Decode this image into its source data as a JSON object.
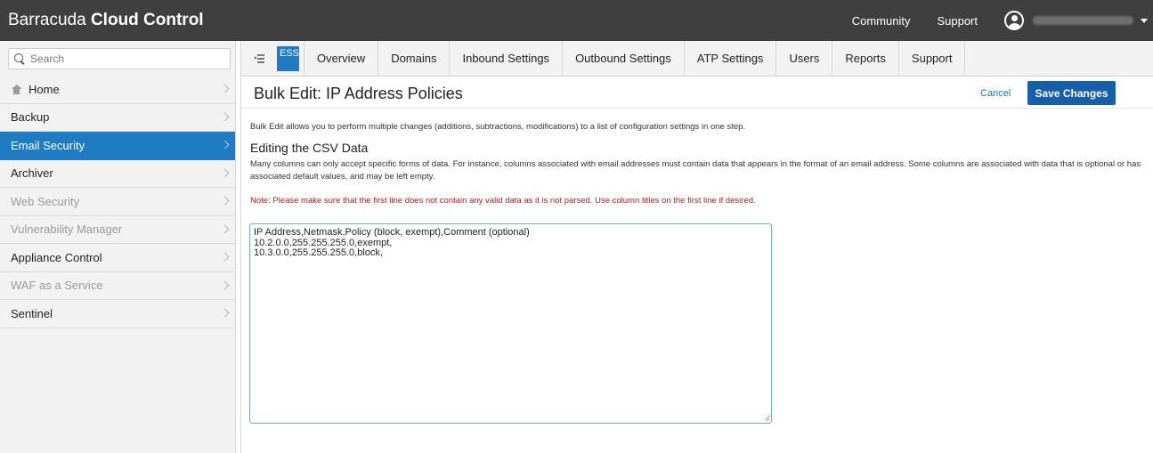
{
  "app": {
    "brand_light": "Barracuda",
    "brand_bold": "Cloud Control"
  },
  "topnav": {
    "community": "Community",
    "support": "Support"
  },
  "sidebar": {
    "search_placeholder": "Search",
    "items": [
      {
        "label": "Home",
        "icon": "home-icon",
        "state": "normal"
      },
      {
        "label": "Backup",
        "state": "normal"
      },
      {
        "label": "Email Security",
        "state": "active"
      },
      {
        "label": "Archiver",
        "state": "normal"
      },
      {
        "label": "Web Security",
        "state": "disabled"
      },
      {
        "label": "Vulnerability Manager",
        "state": "disabled"
      },
      {
        "label": "Appliance Control",
        "state": "normal"
      },
      {
        "label": "WAF as a Service",
        "state": "disabled"
      },
      {
        "label": "Sentinel",
        "state": "normal"
      }
    ]
  },
  "tabs": {
    "badge": "ESS",
    "items": [
      "Overview",
      "Domains",
      "Inbound Settings",
      "Outbound Settings",
      "ATP Settings",
      "Users",
      "Reports",
      "Support"
    ]
  },
  "page": {
    "title": "Bulk Edit: IP Address Policies",
    "cancel": "Cancel",
    "save": "Save Changes",
    "intro": "Bulk Edit allows you to perform multiple changes (additions, subtractions, modifications) to a list of configuration settings in one step.",
    "section_title": "Editing the CSV Data",
    "section_desc": "Many columns can only accept specific forms of data. For instance, columns associated with email addresses must contain data that appears in the format of an email address. Some columns are associated with data that is optional or has associated default values, and may be left empty.",
    "note": "Note: Please make sure that the first line does not contain any valid data as it is not parsed. Use column titles on the first line if desired.",
    "csv": "IP Address,Netmask,Policy (block, exempt),Comment (optional)\n10.2.0.0,255.255.255.0,exempt,\n10.3.0.0,255.255.255.0,block,"
  },
  "colors": {
    "topbar": "#3f3f3f",
    "accent": "#1f7bc2",
    "button": "#175fa8",
    "note": "#b01e1e"
  }
}
